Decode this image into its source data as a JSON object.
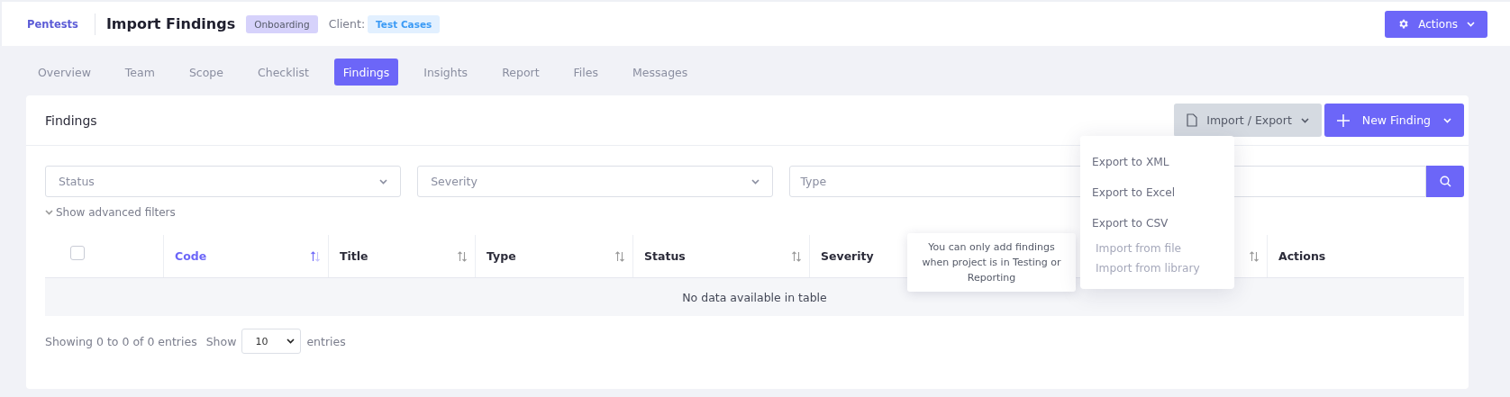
{
  "header": {
    "breadcrumb": "Pentests",
    "title": "Import Findings",
    "status_badge": "Onboarding",
    "client_label": "Client:",
    "client_badge": "Test Cases",
    "actions_button": "Actions"
  },
  "tabs": [
    {
      "label": "Overview",
      "selected": false
    },
    {
      "label": "Team",
      "selected": false
    },
    {
      "label": "Scope",
      "selected": false
    },
    {
      "label": "Checklist",
      "selected": false
    },
    {
      "label": "Findings",
      "selected": true
    },
    {
      "label": "Insights",
      "selected": false
    },
    {
      "label": "Report",
      "selected": false
    },
    {
      "label": "Files",
      "selected": false
    },
    {
      "label": "Messages",
      "selected": false
    }
  ],
  "card": {
    "title": "Findings",
    "import_export_button": "Import / Export",
    "new_finding_button": "New Finding"
  },
  "filters": [
    {
      "placeholder": "Status",
      "kind": "select"
    },
    {
      "placeholder": "Severity",
      "kind": "select"
    },
    {
      "placeholder": "Type",
      "kind": "search"
    }
  ],
  "advanced_filters": "Show advanced filters",
  "table": {
    "select_all_checked": false,
    "columns": [
      {
        "label": "Code",
        "sorted": true
      },
      {
        "label": "Title",
        "sorted": false
      },
      {
        "label": "Type",
        "sorted": false
      },
      {
        "label": "Status",
        "sorted": false
      },
      {
        "label": "Severity",
        "sortable": false
      },
      {
        "sorted": false
      },
      {
        "label": "Actions",
        "sortable": false
      }
    ],
    "empty_message": "No data available in table"
  },
  "footer": {
    "info": "Showing 0 to 0 of 0 entries",
    "show_label": "Show",
    "page_size": "10",
    "entries_label": "entries"
  },
  "menu": [
    {
      "label": "Export to XML",
      "disabled": false
    },
    {
      "label": "Export to Excel",
      "disabled": false
    },
    {
      "label": "Export to CSV",
      "disabled": false
    },
    {
      "label": "Import from file",
      "disabled": true
    },
    {
      "label": "Import from library",
      "disabled": true
    }
  ],
  "tooltip": "You can only add findings when project is in Testing or Reporting"
}
